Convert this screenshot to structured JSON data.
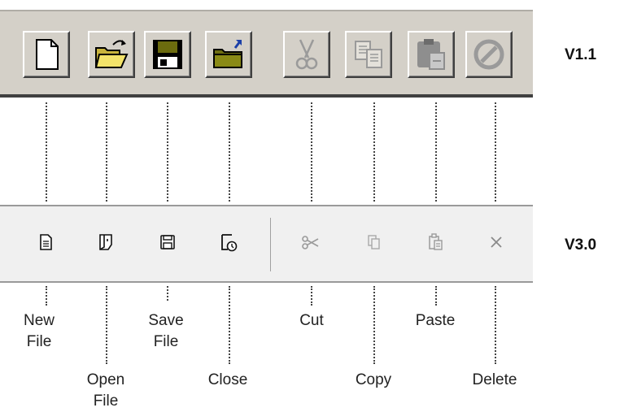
{
  "versions": {
    "v1": "V1.1",
    "v3": "V3.0"
  },
  "toolbar_v1": {
    "buttons": [
      {
        "icon": "new-file-icon",
        "enabled": true
      },
      {
        "icon": "open-folder-icon",
        "enabled": true
      },
      {
        "icon": "floppy-disk-icon",
        "enabled": true
      },
      {
        "icon": "close-folder-icon",
        "enabled": true
      },
      {
        "icon": "scissors-icon",
        "enabled": false
      },
      {
        "icon": "copy-icon",
        "enabled": false
      },
      {
        "icon": "paste-icon",
        "enabled": false
      },
      {
        "icon": "delete-icon",
        "enabled": false
      }
    ]
  },
  "toolbar_v3": {
    "buttons": [
      {
        "icon": "new-file-icon",
        "enabled": true
      },
      {
        "icon": "open-file-icon",
        "enabled": true
      },
      {
        "icon": "save-icon",
        "enabled": true
      },
      {
        "icon": "close-icon",
        "enabled": true
      },
      {
        "icon": "scissors-icon",
        "enabled": false
      },
      {
        "icon": "copy-icon",
        "enabled": false
      },
      {
        "icon": "paste-icon",
        "enabled": false
      },
      {
        "icon": "delete-x-icon",
        "enabled": false
      }
    ]
  },
  "captions": {
    "new_file_1": "New",
    "new_file_2": "File",
    "open_file_1": "Open",
    "open_file_2": "File",
    "save_file_1": "Save",
    "save_file_2": "File",
    "close": "Close",
    "cut": "Cut",
    "copy": "Copy",
    "paste": "Paste",
    "delete": "Delete"
  },
  "colors": {
    "classic_face": "#d4d0c8",
    "modern_face": "#f0f0f0",
    "folder_yellow": "#f3e36a",
    "folder_green": "#6e6e12",
    "disabled_gray": "#a8a8a8"
  }
}
